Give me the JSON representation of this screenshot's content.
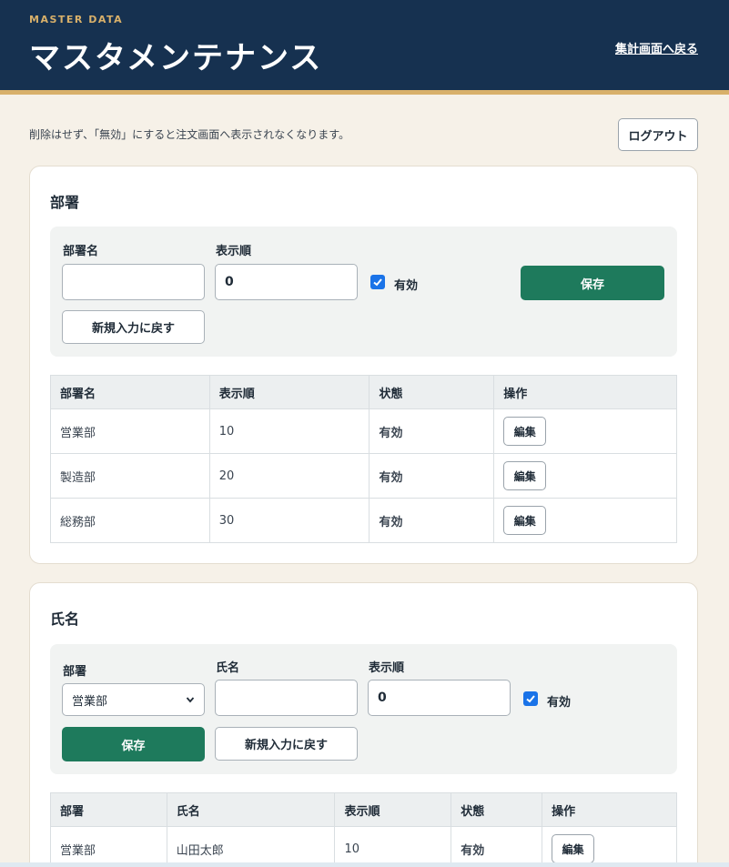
{
  "header": {
    "eyebrow": "MASTER DATA",
    "title": "マスタメンテナンス",
    "back_link": "集計画面へ戻る"
  },
  "notice": "削除はせず、「無効」にすると注文画面へ表示されなくなります。",
  "logout_label": "ログアウト",
  "departments": {
    "title": "部署",
    "form": {
      "name_label": "部署名",
      "name_value": "",
      "order_label": "表示順",
      "order_value": "0",
      "active_label": "有効",
      "save_label": "保存",
      "reset_label": "新規入力に戻す"
    },
    "columns": [
      "部署名",
      "表示順",
      "状態",
      "操作"
    ],
    "rows": [
      {
        "name": "営業部",
        "order": "10",
        "status": "有効",
        "action": "編集"
      },
      {
        "name": "製造部",
        "order": "20",
        "status": "有効",
        "action": "編集"
      },
      {
        "name": "総務部",
        "order": "30",
        "status": "有効",
        "action": "編集"
      }
    ]
  },
  "people": {
    "title": "氏名",
    "form": {
      "dept_label": "部署",
      "dept_selected": "営業部",
      "name_label": "氏名",
      "name_value": "",
      "order_label": "表示順",
      "order_value": "0",
      "active_label": "有効",
      "save_label": "保存",
      "reset_label": "新規入力に戻す"
    },
    "columns": [
      "部署",
      "氏名",
      "表示順",
      "状態",
      "操作"
    ],
    "rows": [
      {
        "dept": "営業部",
        "name": "山田太郎",
        "order": "10",
        "status": "有効",
        "action": "編集"
      }
    ]
  },
  "colors": {
    "header_bg": "#163150",
    "accent_gold": "#d8b06a",
    "primary_green": "#1e7a5c",
    "checkbox_blue": "#1a73e8",
    "page_bg": "#f6f1e8"
  },
  "icons": {
    "checkbox": "check-icon",
    "select": "chevron-down-icon"
  }
}
